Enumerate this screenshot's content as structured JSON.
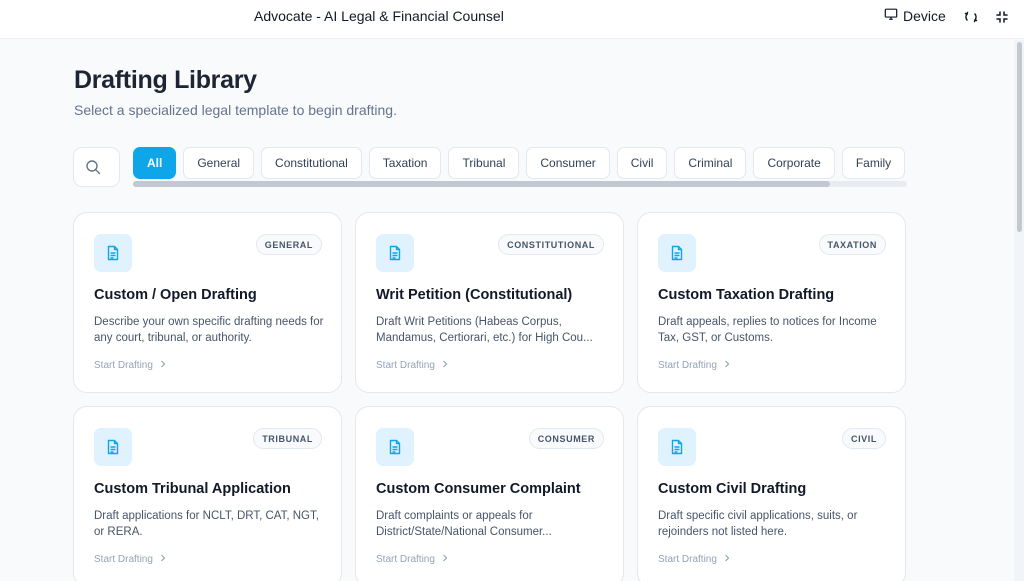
{
  "app": {
    "title": "Advocate - AI Legal & Financial Counsel",
    "device_label": "Device"
  },
  "header": {
    "title": "Drafting Library",
    "subtitle": "Select a specialized legal template to begin drafting."
  },
  "filters": {
    "selected": "All",
    "items": [
      "All",
      "General",
      "Constitutional",
      "Taxation",
      "Tribunal",
      "Consumer",
      "Civil",
      "Criminal",
      "Corporate",
      "Family"
    ]
  },
  "cards": [
    {
      "badge": "GENERAL",
      "title": "Custom / Open Drafting",
      "description": "Describe your own specific drafting needs for any court, tribunal, or authority.",
      "cta": "Start Drafting"
    },
    {
      "badge": "CONSTITUTIONAL",
      "title": "Writ Petition (Constitutional)",
      "description": "Draft Writ Petitions (Habeas Corpus, Mandamus, Certiorari, etc.) for High Cou...",
      "cta": "Start Drafting"
    },
    {
      "badge": "TAXATION",
      "title": "Custom Taxation Drafting",
      "description": "Draft appeals, replies to notices for Income Tax, GST, or Customs.",
      "cta": "Start Drafting"
    },
    {
      "badge": "TRIBUNAL",
      "title": "Custom Tribunal Application",
      "description": "Draft applications for NCLT, DRT, CAT, NGT, or RERA.",
      "cta": "Start Drafting"
    },
    {
      "badge": "CONSUMER",
      "title": "Custom Consumer Complaint",
      "description": "Draft complaints or appeals for District/State/National Consumer...",
      "cta": "Start Drafting"
    },
    {
      "badge": "CIVIL",
      "title": "Custom Civil Drafting",
      "description": "Draft specific civil applications, suits, or rejoinders not listed here.",
      "cta": "Start Drafting"
    }
  ],
  "colors": {
    "accent": "#0ea5e9",
    "icon_bg": "#e0f2fe",
    "background": "#f8fafc"
  },
  "icons": {
    "card": "document-icon",
    "search": "search-icon",
    "device": "monitor-icon",
    "cta": "chevron-right-icon"
  }
}
